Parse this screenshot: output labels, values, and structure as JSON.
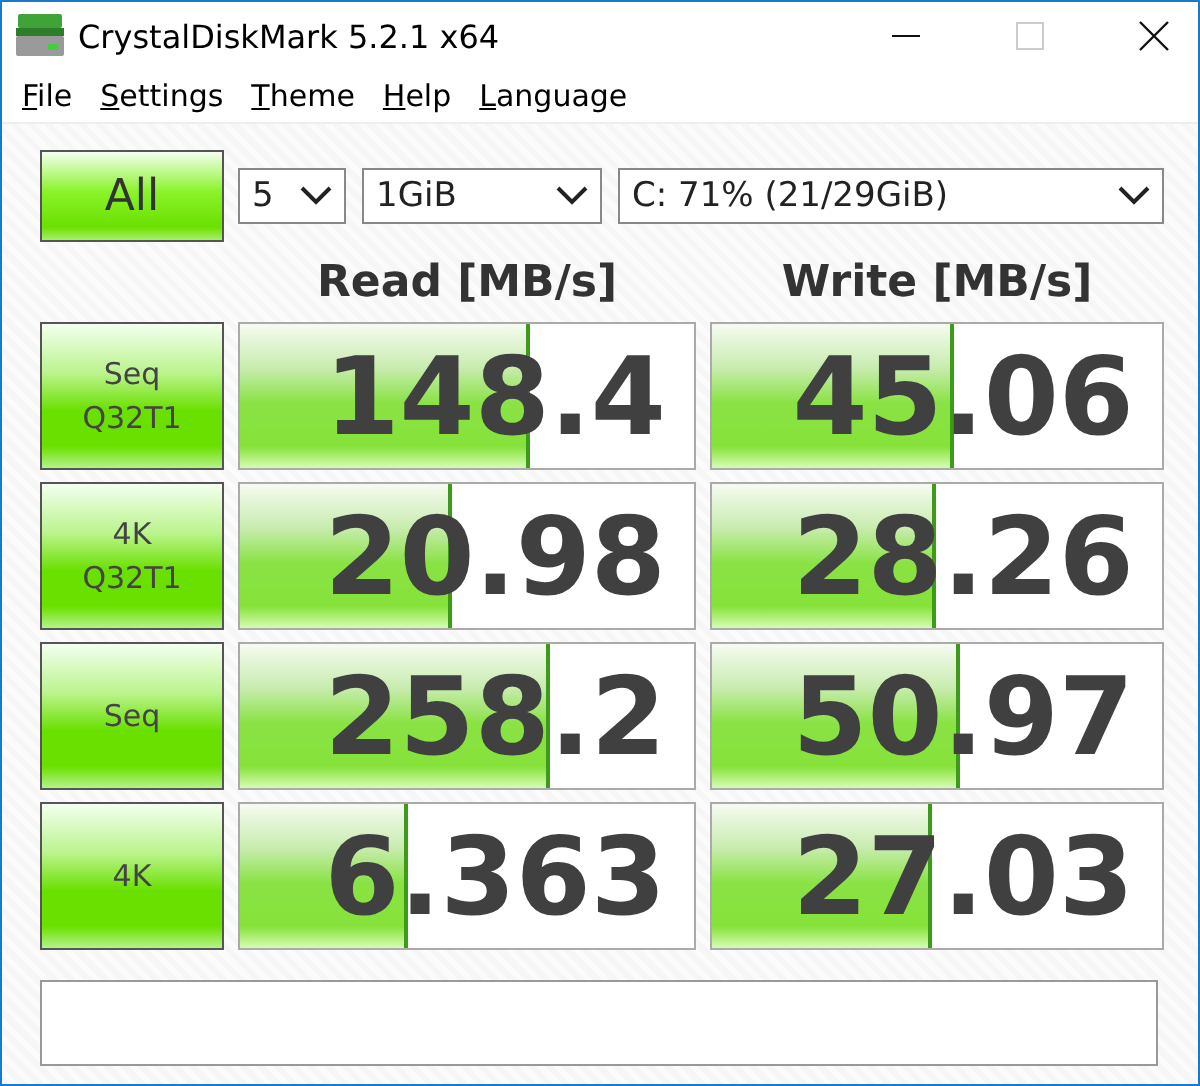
{
  "window": {
    "title": "CrystalDiskMark 5.2.1 x64"
  },
  "menu": [
    "File",
    "Settings",
    "Theme",
    "Help",
    "Language"
  ],
  "controls": {
    "all_button": "All",
    "count": "5",
    "size": "1GiB",
    "drive": "C: 71% (21/29GiB)"
  },
  "headers": [
    "Read [MB/s]",
    "Write [MB/s]"
  ],
  "rows": [
    {
      "label": [
        "Seq",
        "Q32T1"
      ],
      "read": {
        "value": "148.4",
        "level": 0.63
      },
      "write": {
        "value": "45.06",
        "level": 0.53
      }
    },
    {
      "label": [
        "4K",
        "Q32T1"
      ],
      "read": {
        "value": "20.98",
        "level": 0.46
      },
      "write": {
        "value": "28.26",
        "level": 0.49
      }
    },
    {
      "label": [
        "Seq"
      ],
      "read": {
        "value": "258.2",
        "level": 0.675
      },
      "write": {
        "value": "50.97",
        "level": 0.54
      }
    },
    {
      "label": [
        "4K"
      ],
      "read": {
        "value": "6.363",
        "level": 0.36
      },
      "write": {
        "value": "27.03",
        "level": 0.48
      }
    }
  ]
}
